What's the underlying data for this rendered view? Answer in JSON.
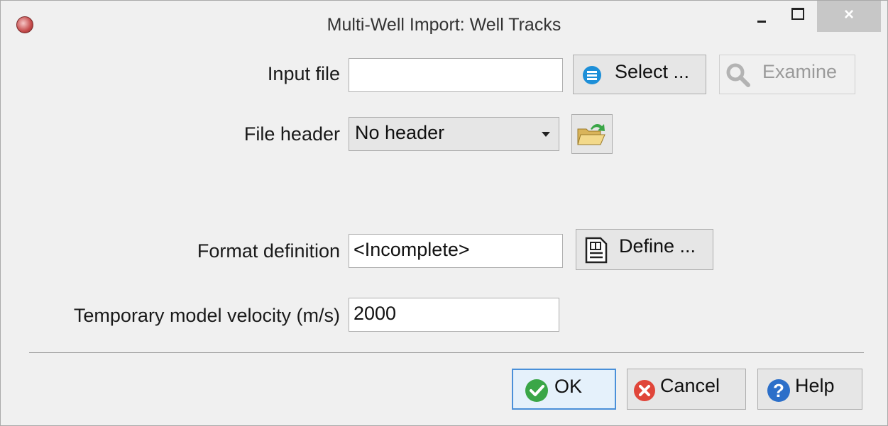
{
  "window": {
    "title": "Multi-Well Import: Well Tracks",
    "close_glyph": "×"
  },
  "form": {
    "input_file": {
      "label": "Input file",
      "value": ""
    },
    "select_button": "Select ...",
    "examine_button": "Examine",
    "file_header": {
      "label": "File header",
      "selected": "No header"
    },
    "format_definition": {
      "label": "Format definition",
      "value": "<Incomplete>"
    },
    "define_button": "Define ...",
    "velocity": {
      "label": "Temporary model velocity (m/s)",
      "value": "2000"
    }
  },
  "footer": {
    "ok": "OK",
    "cancel": "Cancel",
    "help": "Help"
  },
  "icons": {
    "app": "app-logo-icon",
    "select": "list-icon",
    "examine": "magnifier-icon",
    "header_folder": "folder-open-icon",
    "define": "document-edit-icon",
    "ok": "checkmark-icon",
    "cancel": "cancel-x-icon",
    "help": "question-icon"
  },
  "colors": {
    "ok_green": "#3aa647",
    "cancel_red": "#e0463a",
    "help_blue": "#2c6fc9",
    "select_blue": "#1d8fd8"
  }
}
